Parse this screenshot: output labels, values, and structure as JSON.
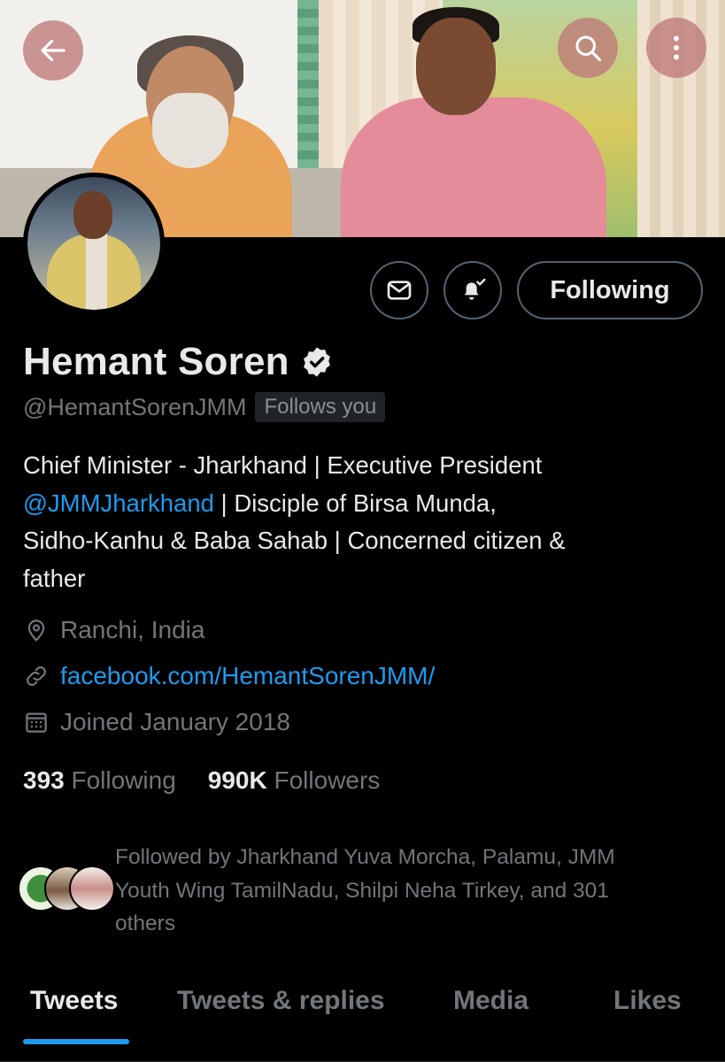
{
  "header": {
    "back_icon": "arrow-left-icon",
    "search_icon": "search-icon",
    "more_icon": "more-vertical-icon"
  },
  "actions": {
    "message_icon": "mail-icon",
    "notify_icon": "bell-check-icon",
    "follow_label": "Following"
  },
  "profile": {
    "name": "Hemant Soren",
    "verified_icon": "verified-badge-icon",
    "handle": "@HemantSorenJMM",
    "follows_you": "Follows you",
    "bio_line1": "Chief Minister - Jharkhand | Executive President",
    "bio_mention": "@JMMJharkhand",
    "bio_line2_rest": " | Disciple of Birsa Munda,",
    "bio_line3": "Sidho-Kanhu & Baba Sahab | Concerned citizen &",
    "bio_line4": "father",
    "location": "Ranchi, India",
    "website": "facebook.com/HemantSorenJMM/",
    "joined": "Joined January 2018"
  },
  "stats": {
    "following_count": "393",
    "following_label": "Following",
    "followers_count": "990K",
    "followers_label": "Followers"
  },
  "followed_by": {
    "line1": "Followed by Jharkhand Yuva Morcha, Palamu, JMM",
    "line2": "Youth Wing TamilNadu, Shilpi Neha Tirkey, and 301",
    "line3": "others"
  },
  "tabs": [
    {
      "label": "Tweets",
      "active": true
    },
    {
      "label": "Tweets & replies",
      "active": false
    },
    {
      "label": "Media",
      "active": false
    },
    {
      "label": "Likes",
      "active": false
    }
  ],
  "colors": {
    "background": "#000000",
    "primary_text": "#e7e9ea",
    "secondary_text": "#71767b",
    "accent": "#1d9bf0"
  }
}
